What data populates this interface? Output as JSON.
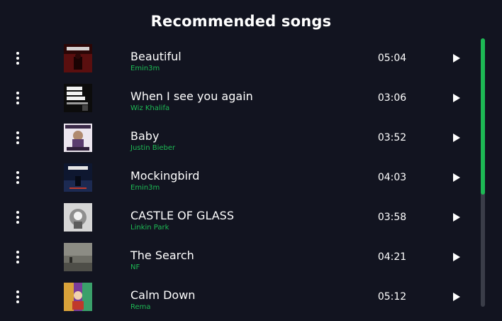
{
  "heading": "Recommended songs",
  "songs": [
    {
      "title": "Beautiful",
      "artist": "Emin3m",
      "duration": "05:04",
      "cover_art": "dark red album cover with text EMIN3M"
    },
    {
      "title": "When I see you again",
      "artist": "Wiz Khalifa",
      "duration": "03:06",
      "cover_art": "black album cover with text SEE YOU AGAIN"
    },
    {
      "title": "Baby",
      "artist": "Justin Bieber",
      "duration": "03:52",
      "cover_art": "purple album cover with text BABY"
    },
    {
      "title": "Mockingbird",
      "artist": "Emin3m",
      "duration": "04:03",
      "cover_art": "dark blue album cover with text ENCORE"
    },
    {
      "title": "CASTLE OF GLASS",
      "artist": "Linkin Park",
      "duration": "03:58",
      "cover_art": "pale grey album cover"
    },
    {
      "title": "The Search",
      "artist": "NF",
      "duration": "04:21",
      "cover_art": "muted grey landscape album cover"
    },
    {
      "title": "Calm Down",
      "artist": "Rema",
      "duration": "05:12",
      "cover_art": "colorful album cover"
    }
  ],
  "icons": {
    "more": "more-vertical-icon",
    "play": "play-icon"
  },
  "colors": {
    "background": "#121420",
    "artist": "#1db954",
    "scroll_thumb": "#1db954",
    "scroll_track": "#3a3d48"
  }
}
